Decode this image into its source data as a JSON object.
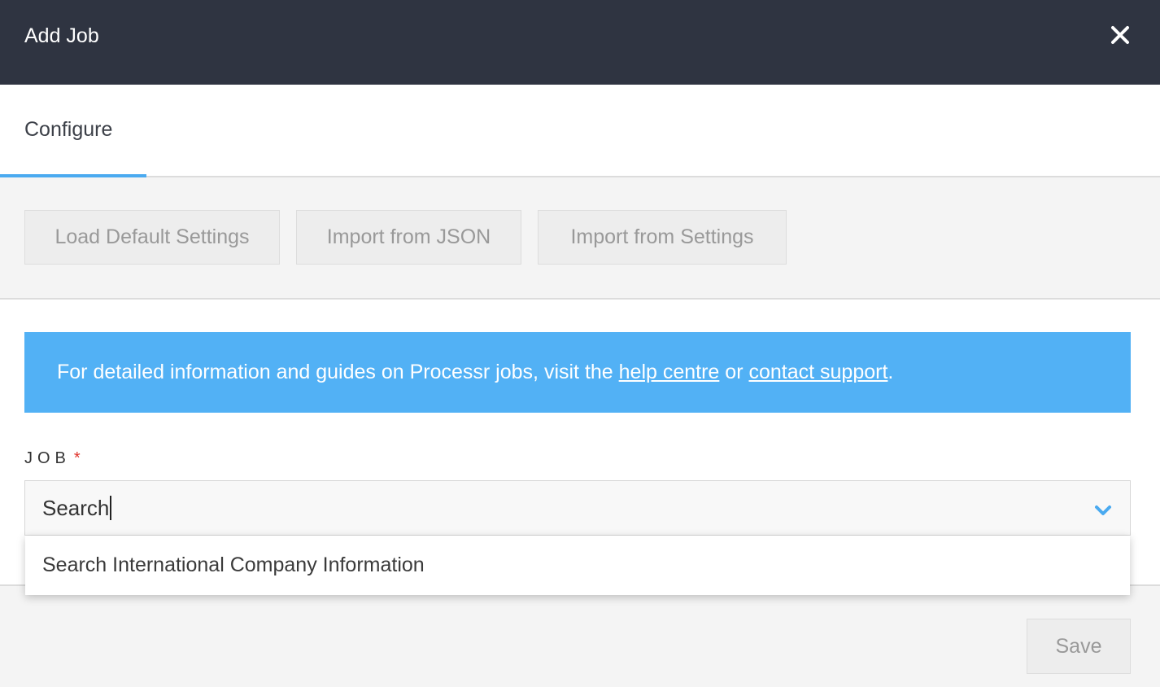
{
  "modal": {
    "title": "Add Job",
    "close_icon": "close-icon"
  },
  "tabs": [
    {
      "label": "Configure",
      "active": true
    }
  ],
  "toolbar": {
    "buttons": [
      {
        "label": "Load Default Settings"
      },
      {
        "label": "Import from JSON"
      },
      {
        "label": "Import from Settings"
      }
    ]
  },
  "info": {
    "text_before": "For detailed information and guides on Processr jobs, visit the ",
    "link1": "help centre",
    "text_between": " or ",
    "link2": "contact support",
    "text_after": "."
  },
  "job_field": {
    "label": "JOB",
    "required_mark": "*",
    "value": "Search",
    "chevron_icon": "chevron-down-icon"
  },
  "dropdown": {
    "options": [
      {
        "label": "Search International Company Information"
      }
    ]
  },
  "footer": {
    "save_label": "Save"
  },
  "colors": {
    "header_bg": "#2f3441",
    "accent": "#4aaaf0",
    "banner_bg": "#52b1f5",
    "required": "#e0332b"
  }
}
